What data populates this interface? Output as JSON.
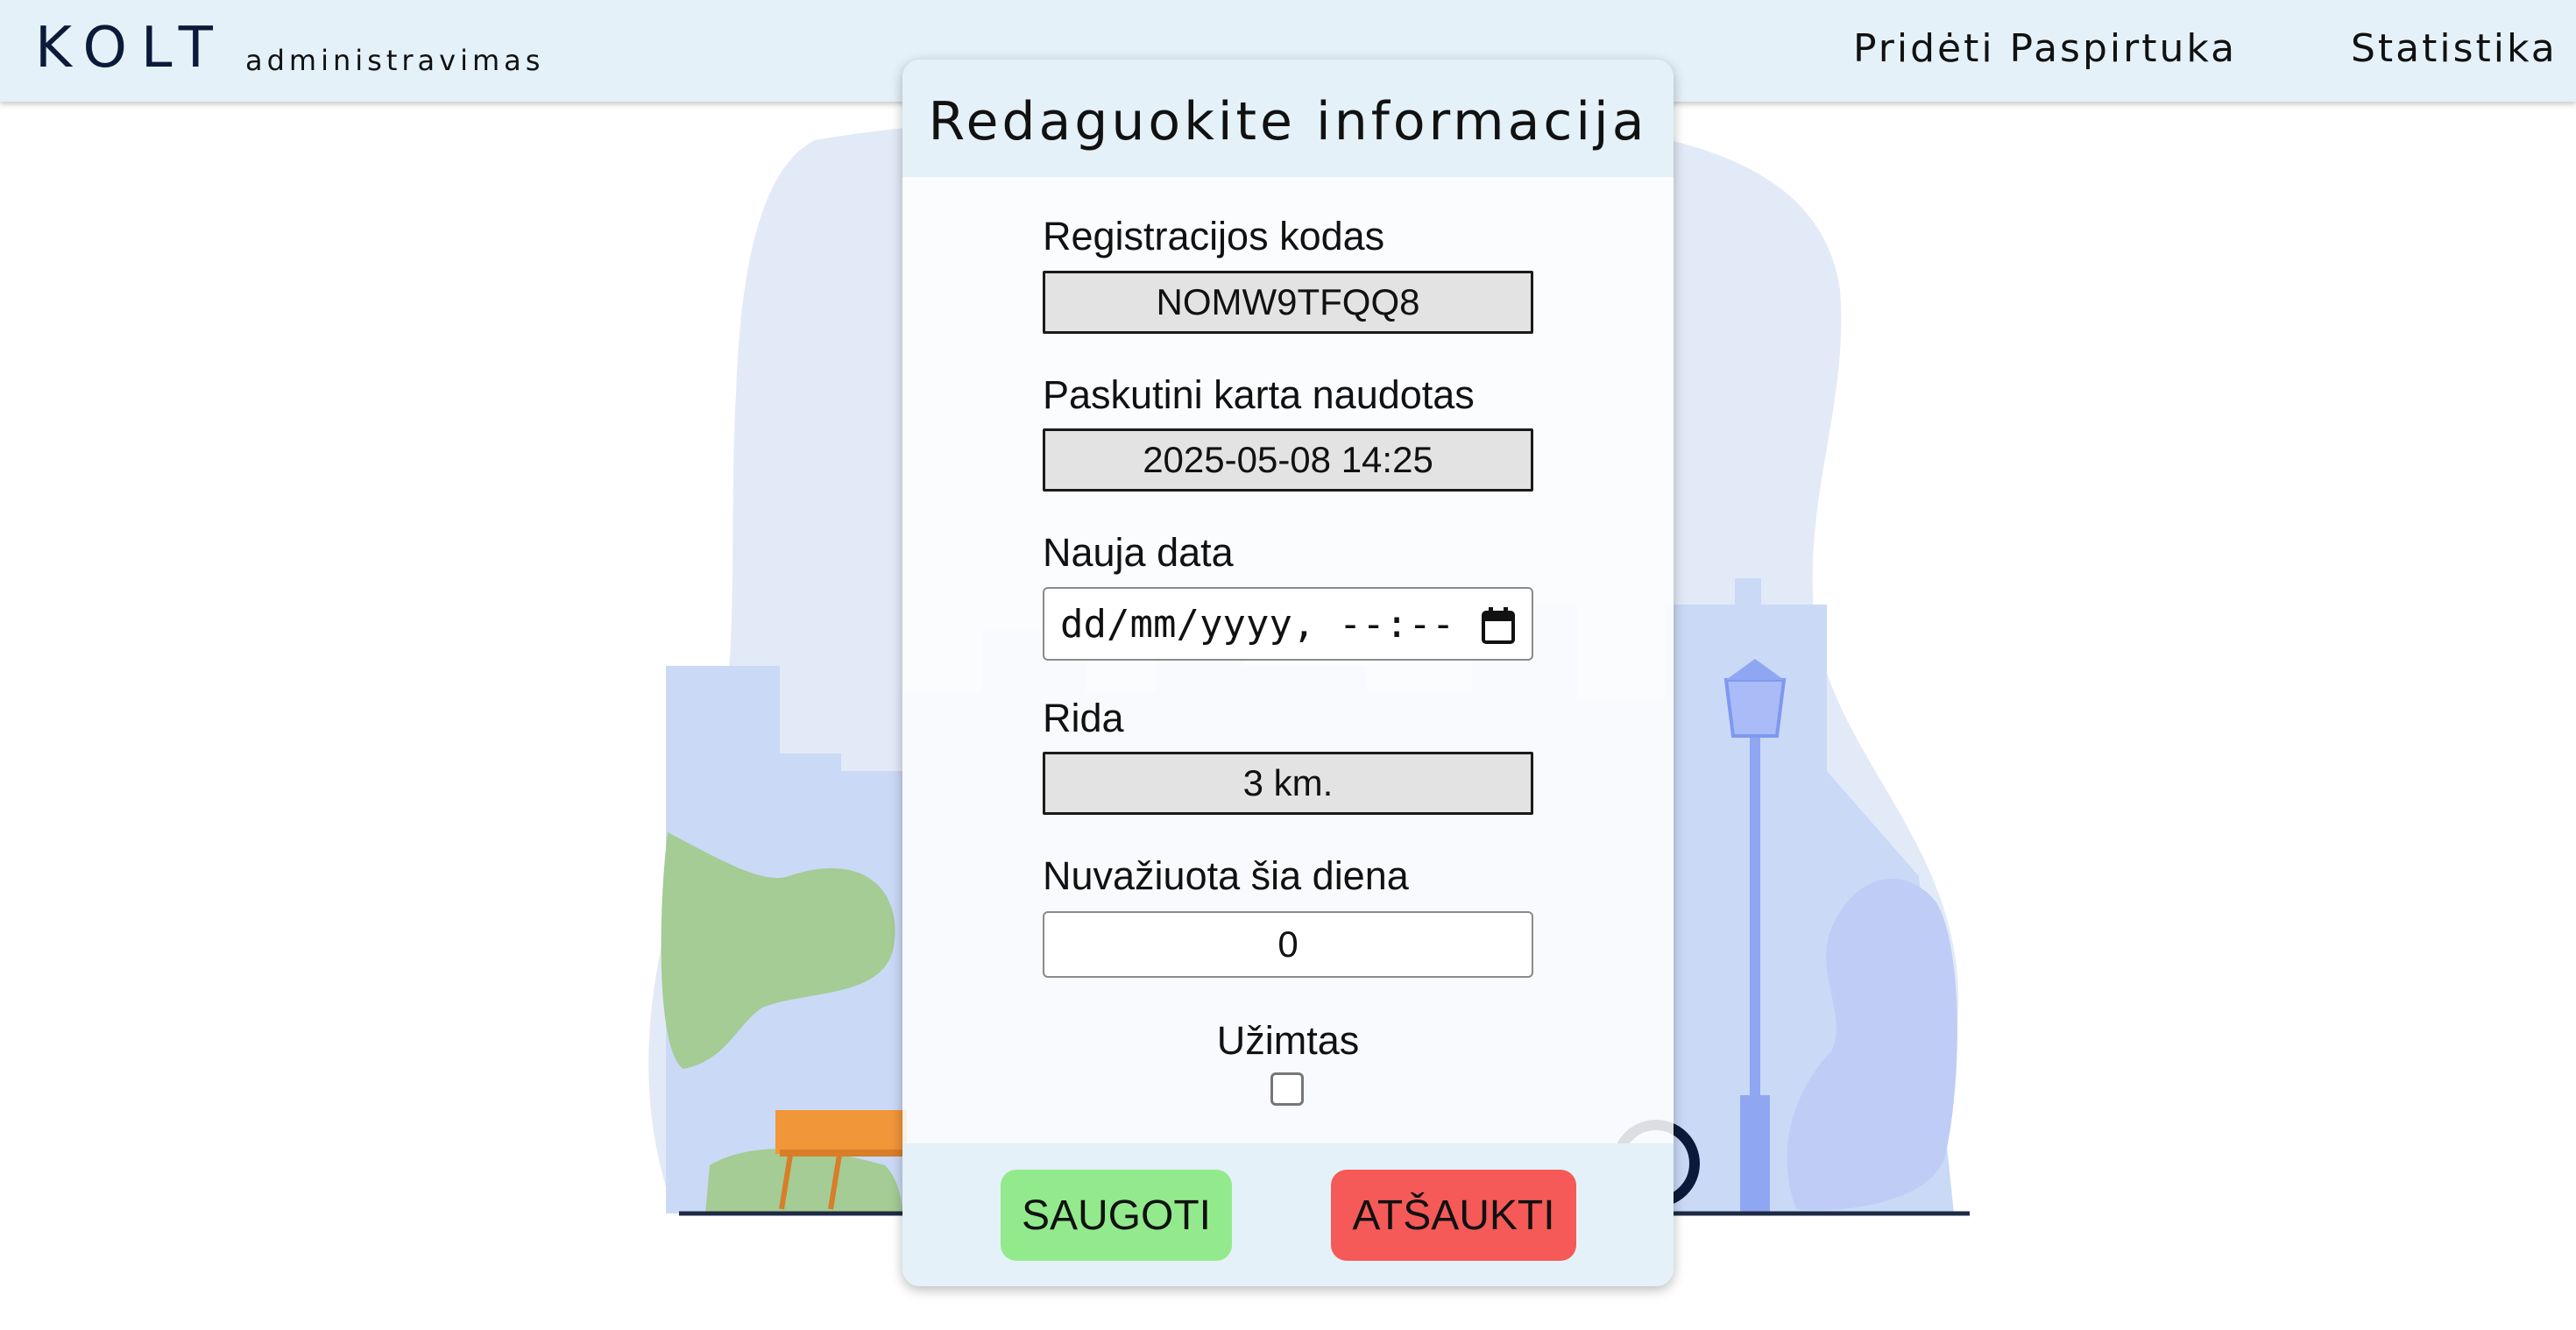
{
  "header": {
    "brand": "KOLT",
    "subtitle": "administravimas",
    "nav": {
      "add_scooter": "Pridėti Paspirtuka",
      "statistics": "Statistika"
    }
  },
  "modal": {
    "title": "Redaguokite informacija",
    "fields": {
      "registration_code": {
        "label": "Registracijos kodas",
        "value": "NOMW9TFQQ8"
      },
      "last_used": {
        "label": "Paskutini karta naudotas",
        "value": "2025-05-08 14:25"
      },
      "new_date": {
        "label": "Nauja data",
        "placeholder": "dd/mm/yyyy, --:--"
      },
      "mileage": {
        "label": "Rida",
        "value": "3 km."
      },
      "distance_today": {
        "label": "Nuvažiuota šia diena",
        "value": "0"
      },
      "occupied": {
        "label": "Užimtas",
        "checked": false
      }
    },
    "buttons": {
      "save": "SAUGOTI",
      "cancel": "ATŠAUKTI"
    }
  },
  "colors": {
    "header_bg": "#e4f1f8",
    "save_button": "#92ea8c",
    "cancel_button": "#f55a58",
    "brand_text": "#0b1a3a"
  }
}
